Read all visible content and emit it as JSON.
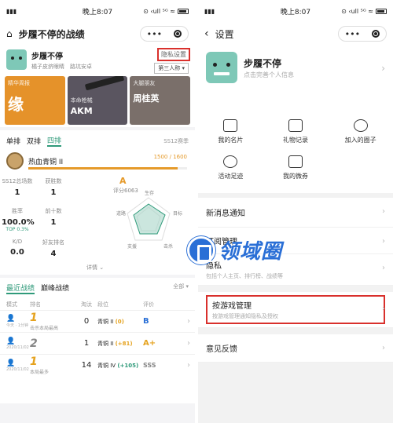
{
  "status": {
    "time": "晚上8:07",
    "icons": "⊙ ‹ull ⁵ᴳ ≈",
    "battery": ""
  },
  "left": {
    "title": "步履不停的战绩",
    "profile": {
      "name": "步履不停",
      "sub1": "橘子皮挤眼睛",
      "sub2": "路坑安卓",
      "privacy": "隐私设置",
      "third_party": "第三人称 ▾"
    },
    "cards": [
      {
        "label": "精华周报",
        "value": "缘"
      },
      {
        "label": "本命枪械",
        "value": "AKM"
      },
      {
        "label": "大腿朋友",
        "value": "周桂英"
      }
    ],
    "modes": [
      "单排",
      "双排",
      "四排"
    ],
    "season": "SS12赛季",
    "rank": {
      "name": "热血青铜 II",
      "points": "1500 / 1600",
      "progress": 0.94
    },
    "stats": [
      {
        "label": "SS12总场数",
        "value": "1"
      },
      {
        "label": "获胜数",
        "value": "1"
      },
      {
        "label": "胜率",
        "value": "100.0%",
        "sub": "TOP 0.3%"
      },
      {
        "label": "前十数",
        "value": "1"
      },
      {
        "label": "K/D",
        "value": "0.0"
      },
      {
        "label": "好友排名",
        "value": "4"
      }
    ],
    "radar": {
      "grade": "A",
      "score": "评分6063",
      "axes": [
        "生存",
        "目标",
        "击杀",
        "支援",
        "道路"
      ]
    },
    "details": "详情 ⌄",
    "records": {
      "tabs": [
        "最近战绩",
        "巅峰战绩"
      ],
      "filter": "全部 ▾",
      "headers": [
        "模式",
        "排名",
        "淘汰",
        "段位",
        "评价"
      ],
      "rows": [
        {
          "mode": "四排",
          "mode_sub": "今天 · 1分钟",
          "rank": "1",
          "rank_sub": "击杀本局最高",
          "kills": "0",
          "tier": "青铜 II",
          "delta": "(0)",
          "grade": "B"
        },
        {
          "mode": "四排",
          "mode_sub": "2020/11/02",
          "rank": "2",
          "rank_sub": "",
          "kills": "1",
          "tier": "青铜 II",
          "delta": "(+81)",
          "grade": "A+"
        },
        {
          "mode": "四排",
          "mode_sub": "2020/11/02",
          "rank": "1",
          "rank_sub": "本局最多",
          "kills": "14",
          "tier": "青铜 IV",
          "delta": "(+105)",
          "grade": "SSS"
        }
      ]
    }
  },
  "right": {
    "title": "设置",
    "profile": {
      "name": "步履不停",
      "sub": "点击完善个人信息"
    },
    "grid": [
      "我的名片",
      "礼物记录",
      "加入的圈子",
      "活动足迹",
      "我的微券"
    ],
    "menu": [
      {
        "label": "新消息通知",
        "sub": ""
      },
      {
        "label": "订阅管理",
        "sub": ""
      },
      {
        "label": "隐私",
        "sub": "包括个人主页、排行榜、战绩等"
      },
      {
        "label": "按游戏管理",
        "sub": "按游戏管理通知隐私及授权"
      },
      {
        "label": "意见反馈",
        "sub": ""
      }
    ]
  },
  "watermark": {
    "text": "领域圈"
  },
  "colors": {
    "accent": "#2f9a7a",
    "highlight": "#d9302c",
    "gold": "#e5a21e",
    "watermark": "#2a6fd6"
  }
}
